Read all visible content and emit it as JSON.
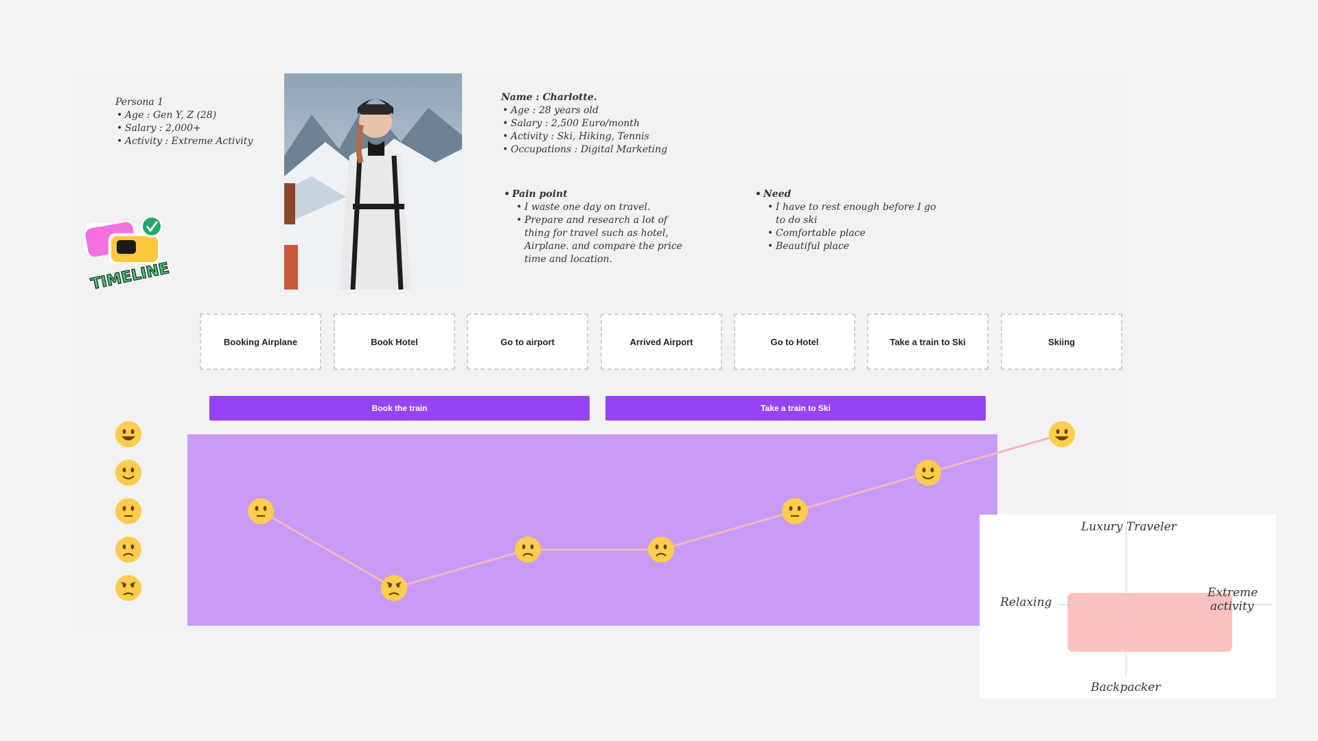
{
  "persona_note": {
    "title": "Persona 1",
    "items": [
      "Age : Gen Y, Z (28)",
      "Salary : 2,000+",
      "Activity : Extreme Activity"
    ]
  },
  "profile": {
    "name": "Name : Charlotte.",
    "items": [
      "Age : 28 years old",
      "Salary : 2,500 Euro/month",
      "Activity : Ski, Hiking, Tennis",
      "Occupations : Digital Marketing"
    ]
  },
  "pain_point": {
    "heading": "Pain point",
    "items": [
      "I waste one day on travel.",
      "Prepare and research a lot of thing for travel such as hotel, Airplane. and compare the price time and location."
    ]
  },
  "need": {
    "heading": "Need",
    "items": [
      "I have to rest enough before  I go to do ski",
      "Comfortable place",
      "Beautiful place"
    ]
  },
  "sticker": {
    "text": "TIMELINE"
  },
  "stages": [
    "Booking Airplane",
    "Book Hotel",
    "Go to airport",
    "Arrived Airport",
    "Go to Hotel",
    "Take a train to Ski",
    "Skiing"
  ],
  "actions": [
    "Book the train",
    "Take a train to Ski"
  ],
  "emotion_scale": [
    "very-happy",
    "happy",
    "neutral",
    "sad",
    "angry"
  ],
  "journey_emotions": [
    "neutral",
    "angry",
    "sad",
    "sad",
    "neutral",
    "happy",
    "very-happy"
  ],
  "quadrant": {
    "top": "Luxury Traveler",
    "bottom": "Backpacker",
    "left": "Relaxing",
    "right_line1": "Extreme",
    "right_line2": "activity"
  },
  "colors": {
    "accent": "#9545f7",
    "panel": "#c79bf7",
    "curve": "#f6b8bd",
    "emoji": "#ffcc4d",
    "highlight": "#fdc1c0"
  }
}
